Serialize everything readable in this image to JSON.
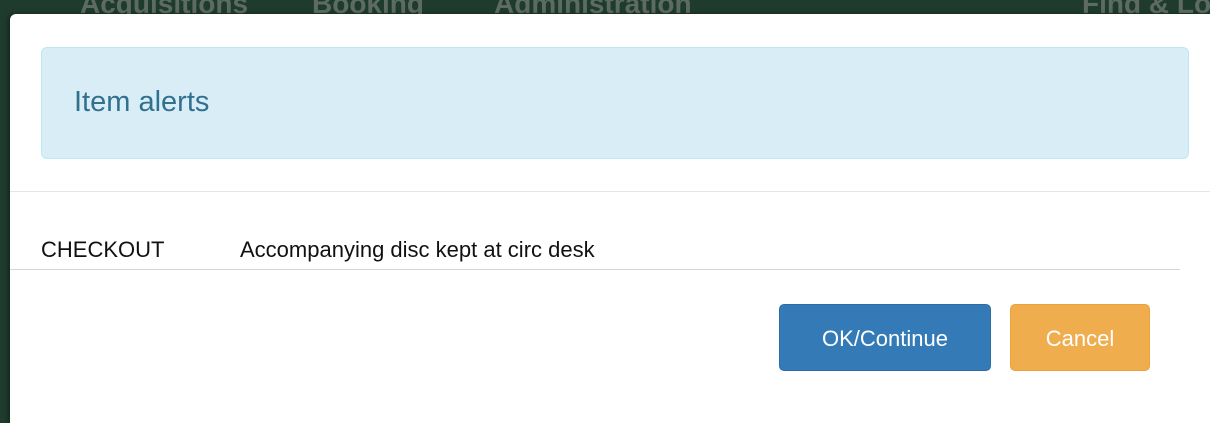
{
  "background_nav": {
    "items": [
      "Acquisitions",
      "Booking",
      "Administration",
      "Find & Lo"
    ]
  },
  "dialog": {
    "title": "Item alerts",
    "alerts": [
      {
        "type": "CHECKOUT",
        "message": "Accompanying disc kept at circ desk"
      }
    ],
    "ok_label": "OK/Continue",
    "cancel_label": "Cancel"
  },
  "colors": {
    "alert_bg": "#d9edf7",
    "alert_text": "#31708f",
    "primary": "#337ab7",
    "warning": "#f0ad4e",
    "navbar": "#1e3b2d"
  }
}
